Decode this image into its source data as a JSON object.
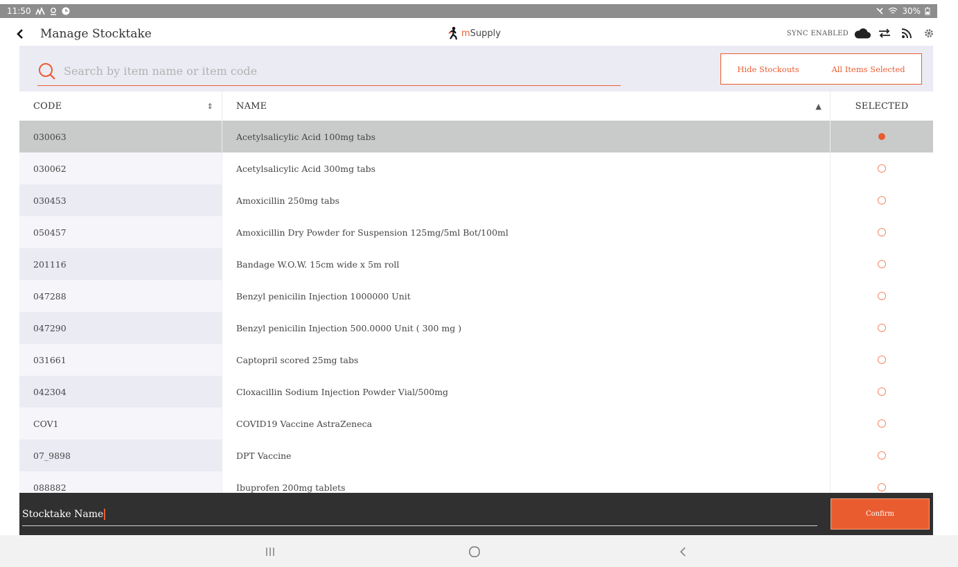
{
  "status_bar": {
    "time": "11:50",
    "left_icons": [
      "signal-icon",
      "location-icon",
      "app-icon"
    ],
    "right_icons": [
      "mute-icon",
      "wifi-icon",
      "battery-icon"
    ],
    "battery": "30%"
  },
  "header": {
    "title": "Manage Stocktake",
    "logo_prefix": "m",
    "logo_text": "Supply",
    "sync_status": "SYNC ENABLED"
  },
  "search": {
    "placeholder": "Search by item name or item code",
    "value": ""
  },
  "filters": {
    "hide_stockouts": "Hide Stockouts",
    "all_items_selected": "All Items Selected"
  },
  "table": {
    "columns": {
      "code": "CODE",
      "name": "NAME",
      "selected": "SELECTED"
    },
    "rows": [
      {
        "code": "030063",
        "name": "Acetylsalicylic Acid 100mg tabs",
        "selected": true
      },
      {
        "code": "030062",
        "name": "Acetylsalicylic Acid 300mg tabs",
        "selected": false
      },
      {
        "code": "030453",
        "name": "Amoxicillin 250mg tabs",
        "selected": false
      },
      {
        "code": "050457",
        "name": "Amoxicillin Dry Powder for Suspension 125mg/5ml Bot/100ml",
        "selected": false
      },
      {
        "code": "201116",
        "name": "Bandage W.O.W. 15cm wide x 5m roll",
        "selected": false
      },
      {
        "code": "047288",
        "name": "Benzyl penicilin Injection 1000000 Unit",
        "selected": false
      },
      {
        "code": "047290",
        "name": "Benzyl penicilin Injection 500.0000 Unit ( 300 mg )",
        "selected": false
      },
      {
        "code": "031661",
        "name": "Captopril scored 25mg tabs",
        "selected": false
      },
      {
        "code": "042304",
        "name": "Cloxacillin Sodium Injection Powder Vial/500mg",
        "selected": false
      },
      {
        "code": "COV1",
        "name": "COVID19 Vaccine AstraZeneca",
        "selected": false
      },
      {
        "code": "07_9898",
        "name": "DPT Vaccine",
        "selected": false
      },
      {
        "code": "088882",
        "name": "Ibuprofen 200mg tablets",
        "selected": false
      }
    ]
  },
  "footer": {
    "stocktake_name": "Stocktake Name",
    "confirm_label": "Confirm"
  },
  "colors": {
    "accent": "#e95c30",
    "band": "#ebebf4",
    "selected_row": "#c9cbcb",
    "footer_bg": "#303030"
  }
}
